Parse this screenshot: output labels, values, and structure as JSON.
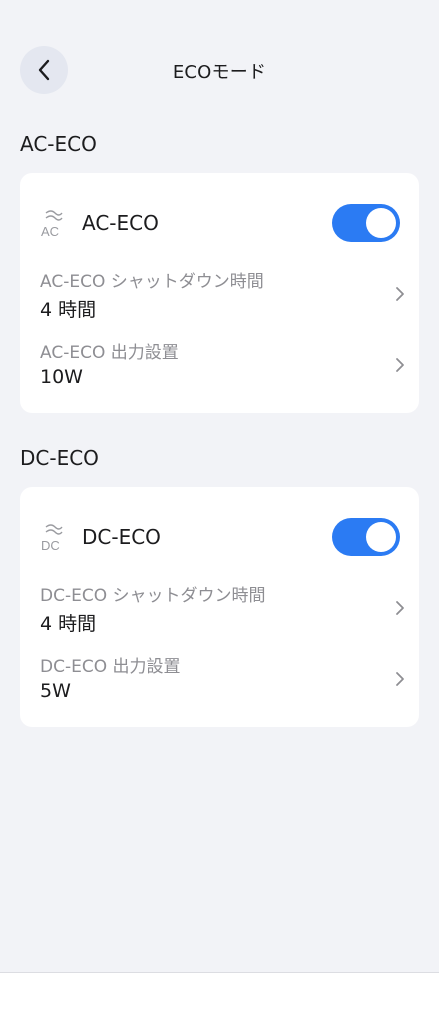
{
  "header": {
    "title": "ECOモード"
  },
  "sections": [
    {
      "heading": "AC-ECO",
      "card": {
        "icon_text": "AC",
        "name": "AC-ECO",
        "toggle_on": true,
        "rows": [
          {
            "label": "AC-ECO シャットダウン時間",
            "value": "4 時間"
          },
          {
            "label": "AC-ECO 出力設置",
            "value": "10W"
          }
        ]
      }
    },
    {
      "heading": "DC-ECO",
      "card": {
        "icon_text": "DC",
        "name": "DC-ECO",
        "toggle_on": true,
        "rows": [
          {
            "label": "DC-ECO シャットダウン時間",
            "value": "4 時間"
          },
          {
            "label": "DC-ECO 出力設置",
            "value": "5W"
          }
        ]
      }
    }
  ],
  "colors": {
    "accent": "#2b7bf3",
    "background": "#f2f3f7",
    "card": "#ffffff"
  },
  "icons": {
    "back": "chevron-left-icon",
    "row": "chevron-right-icon",
    "mode": "eco-wave-icon"
  }
}
